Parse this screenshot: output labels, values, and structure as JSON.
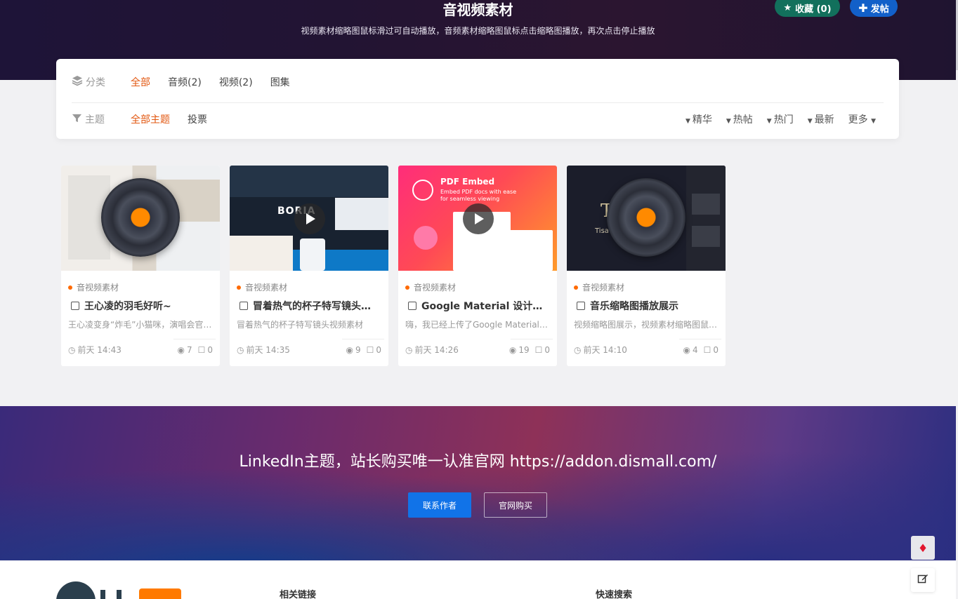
{
  "header": {
    "title": "音视频素材",
    "subtitle": "视频素材缩略图鼠标滑过可自动播放，音频素材缩略图鼠标点击缩略图播放，再次点击停止播放",
    "fav_label": "收藏 (0)",
    "post_label": "发帖",
    "fav_color": "#12705c",
    "post_color": "#1260c9"
  },
  "filter": {
    "category_label": "分类",
    "categories": [
      "全部",
      "音频(2)",
      "视频(2)",
      "图集"
    ],
    "topic_label": "主题",
    "topics": [
      "全部主题",
      "投票"
    ],
    "sorts": [
      "精华",
      "热帖",
      "热门",
      "最新"
    ],
    "more_label": "更多",
    "active_color": "#e25710"
  },
  "cards": [
    {
      "category": "音视频素材",
      "title": "王心凌的羽毛好听~",
      "desc": "王心凌变身“炸毛”小猫咪，演唱会官…",
      "time": "前天 14:43",
      "views": "7",
      "comments": "0",
      "media": "audio"
    },
    {
      "category": "音视频素材",
      "title": "冒着热气的杯子特写镜头…",
      "desc": "冒着热气的杯子特写镜头视频素材",
      "time": "前天 14:35",
      "views": "9",
      "comments": "0",
      "media": "video",
      "thumb_text": "BORIA"
    },
    {
      "category": "音视频素材",
      "title": "Google Material 设计…",
      "desc": "嗨，我已经上传了Google Material…",
      "time": "前天 14:26",
      "views": "19",
      "comments": "0",
      "media": "video",
      "thumb_text": "PDF Embed",
      "thumb_sub": "Embed PDF docs with ease for seamless viewing"
    },
    {
      "category": "音视频素材",
      "title": "音乐缩略图播放展示",
      "desc": "视频缩略图展示，视频素材缩略图鼠…",
      "time": "前天 14:10",
      "views": "4",
      "comments": "0",
      "media": "audio",
      "thumb_text": "T",
      "thumb_sub": "Tisa"
    }
  ],
  "promo": {
    "text": "LinkedIn主题，站长购买唯一认准官网 https://addon.dismall.com/",
    "contact_label": "联系作者",
    "buy_label": "官网购买",
    "contact_color": "#1173e8"
  },
  "footer": {
    "links_title": "相关链接",
    "search_title": "快速搜索"
  },
  "icons": {
    "star": "star-icon",
    "plus": "plus-icon",
    "layers": "layers-icon",
    "filter": "filter-icon",
    "clock": "clock-icon",
    "eye": "eye-icon",
    "comment": "comment-icon",
    "gem": "gem-icon",
    "edit": "edit-icon"
  }
}
